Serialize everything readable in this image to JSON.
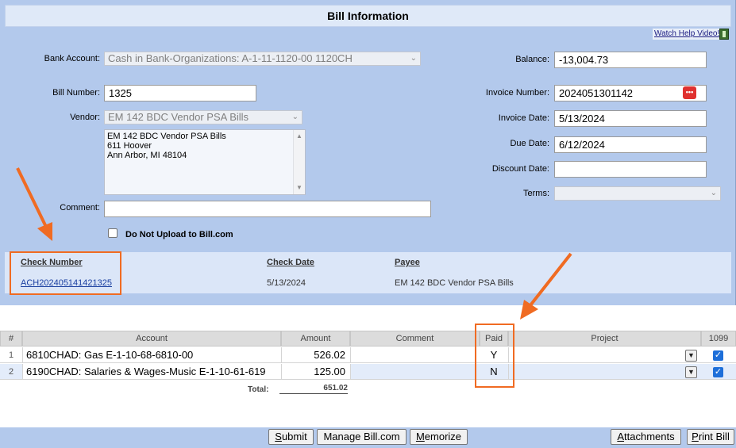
{
  "header": {
    "title": "Bill Information",
    "help_link": "Watch Help Video!"
  },
  "form": {
    "bank_account": {
      "label": "Bank Account:",
      "value": "Cash in Bank-Organizations: A-1-11-1120-00 1120CH"
    },
    "balance": {
      "label": "Balance:",
      "value": "-13,004.73"
    },
    "bill_number": {
      "label": "Bill Number:",
      "value": "1325"
    },
    "invoice_number": {
      "label": "Invoice Number:",
      "value": "2024051301142"
    },
    "vendor": {
      "label": "Vendor:",
      "value": "EM 142 BDC Vendor PSA Bills"
    },
    "vendor_address": [
      "EM 142 BDC Vendor PSA Bills",
      "611 Hoover",
      "Ann Arbor, MI 48104"
    ],
    "invoice_date": {
      "label": "Invoice Date:",
      "value": "5/13/2024"
    },
    "due_date": {
      "label": "Due Date:",
      "value": "6/12/2024"
    },
    "discount_date": {
      "label": "Discount Date:",
      "value": ""
    },
    "terms": {
      "label": "Terms:",
      "value": ""
    },
    "comment": {
      "label": "Comment:",
      "value": ""
    },
    "no_upload": {
      "label": "Do Not Upload to Bill.com",
      "checked": false
    }
  },
  "checks": {
    "headers": {
      "number": "Check Number",
      "date": "Check Date",
      "payee": "Payee"
    },
    "rows": [
      {
        "number": "ACH202405141421325",
        "date": "5/13/2024",
        "payee": "EM 142 BDC Vendor PSA Bills"
      }
    ]
  },
  "lines": {
    "headers": {
      "num": "#",
      "account": "Account",
      "amount": "Amount",
      "comment": "Comment",
      "paid": "Paid",
      "project": "Project",
      "t1099": "1099"
    },
    "rows": [
      {
        "num": "1",
        "account": "6810CHAD: Gas E-1-10-68-6810-00",
        "amount": "526.02",
        "comment": "",
        "paid": "Y",
        "project": "",
        "t1099": true
      },
      {
        "num": "2",
        "account": "6190CHAD: Salaries & Wages-Music E-1-10-61-619",
        "amount": "125.00",
        "comment": "",
        "paid": "N",
        "project": "",
        "t1099": true
      }
    ],
    "total_label": "Total:",
    "total_value": "651.02"
  },
  "buttons": {
    "submit": {
      "hot": "S",
      "rest": "ubmit"
    },
    "manage": "Manage Bill.com",
    "memorize": {
      "hot": "M",
      "rest": "emorize"
    },
    "attachments": {
      "hot": "A",
      "rest": "ttachments"
    },
    "print": {
      "hot": "P",
      "rest": "rint Bill"
    }
  },
  "colors": {
    "panel": "#b3c9ec",
    "highlight": "#f06b22",
    "link": "#1a3fa0"
  }
}
